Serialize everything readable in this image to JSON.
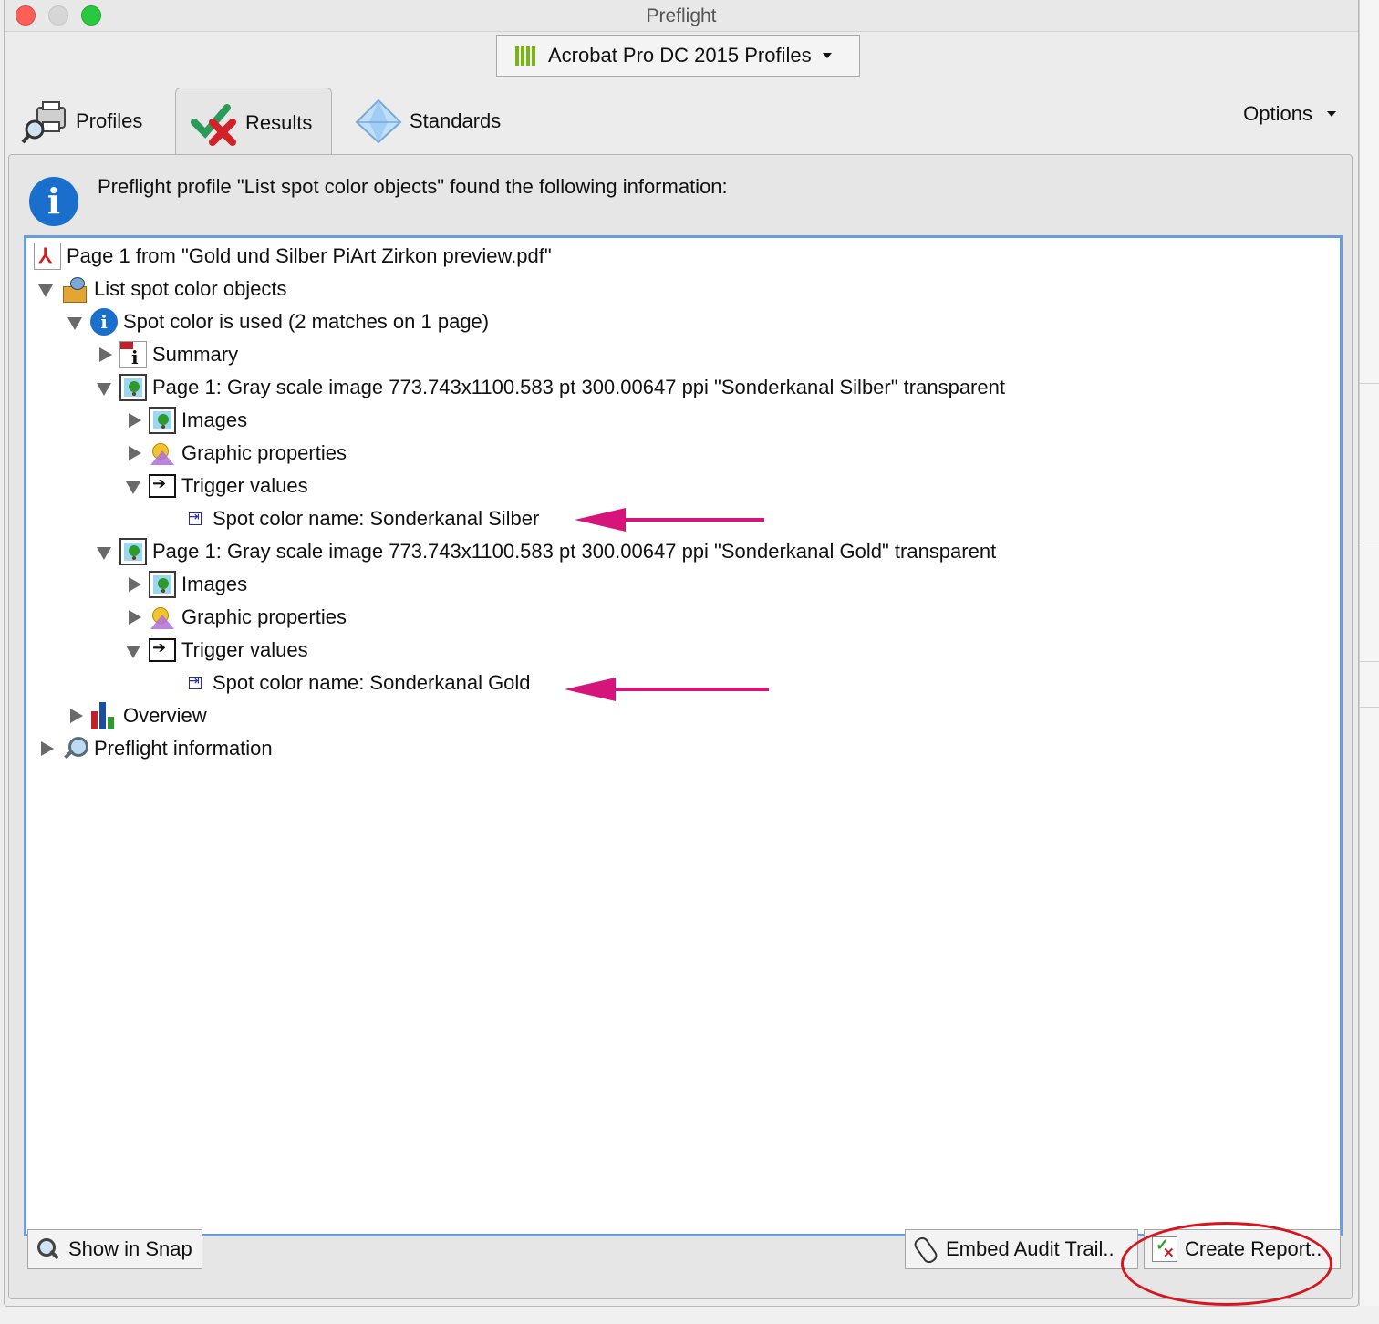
{
  "window": {
    "title": "Preflight"
  },
  "profile_selector": {
    "label": "Acrobat Pro DC 2015 Profiles"
  },
  "tabs": [
    {
      "label": "Profiles",
      "icon": "printer-magnifier-icon"
    },
    {
      "label": "Results",
      "icon": "check-cross-icon",
      "selected": true
    },
    {
      "label": "Standards",
      "icon": "diamond-icon"
    }
  ],
  "options": {
    "label": "Options"
  },
  "info_message": "Preflight profile \"List spot color objects\" found the following information:",
  "tree": [
    {
      "label": "Page 1 from \"Gold und Silber PiArt Zirkon preview.pdf\"",
      "icon": "pdf-icon"
    },
    {
      "label": "List spot color objects",
      "icon": "list-objects-icon"
    },
    {
      "label": "Spot color is used (2 matches on 1 page)",
      "icon": "info-icon"
    },
    {
      "label": "Summary",
      "icon": "summary-icon"
    },
    {
      "label": "Page 1: Gray scale image 773.743x1100.583 pt 300.00647 ppi \"Sonderkanal Silber\" transparent",
      "icon": "image-icon"
    },
    {
      "label": "Images",
      "icon": "image-icon"
    },
    {
      "label": "Graphic properties",
      "icon": "graphic-properties-icon"
    },
    {
      "label": "Trigger values",
      "icon": "trigger-icon"
    },
    {
      "label": "Spot color name: Sonderkanal Silber",
      "icon": "value-icon"
    },
    {
      "label": "Page 1: Gray scale image 773.743x1100.583 pt 300.00647 ppi \"Sonderkanal Gold\" transparent",
      "icon": "image-icon"
    },
    {
      "label": "Images",
      "icon": "image-icon"
    },
    {
      "label": "Graphic properties",
      "icon": "graphic-properties-icon"
    },
    {
      "label": "Trigger values",
      "icon": "trigger-icon"
    },
    {
      "label": "Spot color name: Sonderkanal Gold",
      "icon": "value-icon"
    },
    {
      "label": "Overview",
      "icon": "overview-chart-icon"
    },
    {
      "label": "Preflight information",
      "icon": "preflight-magnifier-icon"
    }
  ],
  "buttons": {
    "show_in_snap": "Show in Snap",
    "embed_audit_trail": "Embed Audit Trail..",
    "create_report": "Create Report.."
  },
  "colors": {
    "annotation_arrow": "#d6157b",
    "annotation_circle": "#d8141e",
    "info_blue": "#1a6fcc",
    "selection_border": "#6b9ddc"
  }
}
